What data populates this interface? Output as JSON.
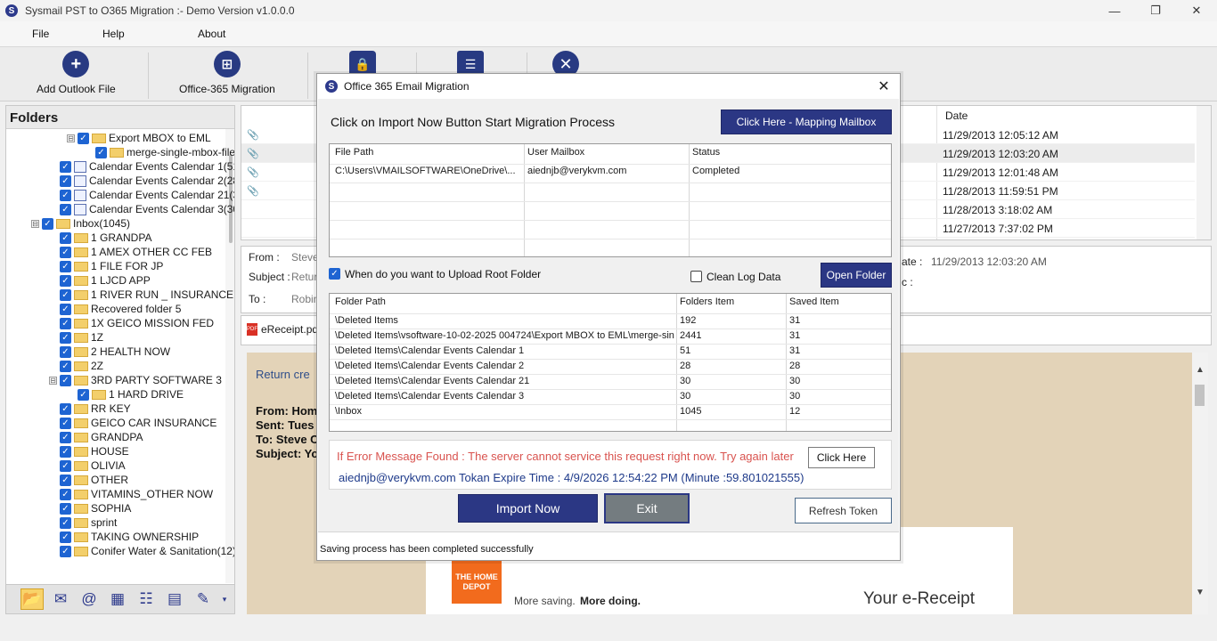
{
  "window": {
    "title": "Sysmail PST to O365 Migration :- Demo Version v1.0.0.0",
    "logo_letter": "S",
    "controls": [
      "—",
      "❐",
      "✕"
    ]
  },
  "menu": {
    "file": "File",
    "help": "Help",
    "about": "About"
  },
  "toolbar": {
    "add_outlook": "Add Outlook File",
    "office365": "Office-365 Migration"
  },
  "folders": {
    "header": "Folders",
    "items": [
      {
        "label": "Export MBOX to EML",
        "indent": 1,
        "type": "folder",
        "expander": "⊟"
      },
      {
        "label": "merge-single-mbox-file.r",
        "indent": 2,
        "type": "folder",
        "expander": ""
      },
      {
        "label": "Calendar Events Calendar 1(51",
        "indent": 0,
        "type": "cal",
        "expander": ""
      },
      {
        "label": "Calendar Events Calendar 2(28",
        "indent": 0,
        "type": "cal",
        "expander": ""
      },
      {
        "label": "Calendar Events Calendar 21(3",
        "indent": 0,
        "type": "cal",
        "expander": ""
      },
      {
        "label": "Calendar Events Calendar 3(30",
        "indent": 0,
        "type": "cal",
        "expander": ""
      },
      {
        "label": "Inbox(1045)",
        "indent": -1,
        "type": "folder",
        "expander": "⊟"
      },
      {
        "label": "1  GRANDPA",
        "indent": 0,
        "type": "folder",
        "expander": ""
      },
      {
        "label": "1 AMEX OTHER CC FEB",
        "indent": 0,
        "type": "folder",
        "expander": ""
      },
      {
        "label": "1 FILE FOR JP",
        "indent": 0,
        "type": "folder",
        "expander": ""
      },
      {
        "label": "1 LJCD APP",
        "indent": 0,
        "type": "folder",
        "expander": ""
      },
      {
        "label": "1 RIVER RUN _ INSURANCE",
        "indent": 0,
        "type": "folder",
        "expander": ""
      },
      {
        "label": "Recovered folder 5",
        "indent": 0,
        "type": "folder",
        "expander": ""
      },
      {
        "label": "1X GEICO MISSION FED",
        "indent": 0,
        "type": "folder",
        "expander": ""
      },
      {
        "label": "1Z",
        "indent": 0,
        "type": "folder",
        "expander": ""
      },
      {
        "label": "2 HEALTH NOW",
        "indent": 0,
        "type": "folder",
        "expander": ""
      },
      {
        "label": "2Z",
        "indent": 0,
        "type": "folder",
        "expander": ""
      },
      {
        "label": "3RD PARTY SOFTWARE 3",
        "indent": 0,
        "type": "folder",
        "expander": "⊟"
      },
      {
        "label": "1 HARD DRIVE",
        "indent": 1,
        "type": "folder",
        "expander": ""
      },
      {
        "label": "RR KEY",
        "indent": 0,
        "type": "folder",
        "expander": ""
      },
      {
        "label": "GEICO  CAR INSURANCE",
        "indent": 0,
        "type": "folder",
        "expander": ""
      },
      {
        "label": "GRANDPA",
        "indent": 0,
        "type": "folder",
        "expander": ""
      },
      {
        "label": "HOUSE",
        "indent": 0,
        "type": "folder",
        "expander": ""
      },
      {
        "label": "OLIVIA",
        "indent": 0,
        "type": "folder",
        "expander": ""
      },
      {
        "label": "OTHER",
        "indent": 0,
        "type": "folder",
        "expander": ""
      },
      {
        "label": "VITAMINS_OTHER NOW",
        "indent": 0,
        "type": "folder",
        "expander": ""
      },
      {
        "label": "SOPHIA",
        "indent": 0,
        "type": "folder",
        "expander": ""
      },
      {
        "label": "sprint",
        "indent": 0,
        "type": "folder",
        "expander": ""
      },
      {
        "label": "TAKING OWNERSHIP",
        "indent": 0,
        "type": "folder",
        "expander": ""
      },
      {
        "label": "Conifer Water & Sanitation(12)",
        "indent": 0,
        "type": "folder",
        "expander": ""
      }
    ]
  },
  "mail_list": {
    "date_header": "Date",
    "rows": [
      {
        "date": "11/29/2013 12:05:12 AM",
        "selected": false
      },
      {
        "date": "11/29/2013 12:03:20 AM",
        "selected": true
      },
      {
        "date": "11/29/2013 12:01:48 AM",
        "selected": false
      },
      {
        "date": "11/28/2013 11:59:51 PM",
        "selected": false
      },
      {
        "date": "11/28/2013 3:18:02 AM",
        "selected": false
      },
      {
        "date": "11/27/2013 7:37:02 PM",
        "selected": false
      }
    ]
  },
  "preview": {
    "from_label": "From :",
    "from_value": "Steve",
    "subject_label": "Subject :",
    "subject_value": "Retur",
    "to_label": "To :",
    "to_value": "Robin",
    "date_label": "ate :",
    "date_value": "11/29/2013 12:03:20 AM",
    "cc_label": "c :",
    "attachment": "eReceipt.pdf",
    "body_heading": "Return cre",
    "body_from": "From: Home",
    "body_sent": "Sent: Tues",
    "body_to": "To: Steve C",
    "body_subject": "Subject: Yo",
    "tagline_a": "More saving.",
    "tagline_b": "More doing.",
    "receipt_title": "Your e-Receipt",
    "logo_text": "THE HOME DEPOT"
  },
  "dialog": {
    "title": "Office 365 Email Migration",
    "close": "✕",
    "instruction": "Click on Import Now Button Start Migration Process",
    "mapping_button": "Click Here - Mapping Mailbox",
    "files_table": {
      "headers": [
        "File Path",
        "User Mailbox",
        "Status"
      ],
      "rows": [
        [
          "C:\\Users\\VMAILSOFTWARE\\OneDrive\\...",
          "aiednjb@verykvm.com",
          "Completed"
        ]
      ]
    },
    "upload_root_label": "When do you want to Upload Root Folder",
    "upload_root_checked": true,
    "clean_log_label": "Clean Log Data",
    "clean_log_checked": false,
    "open_folder": "Open Folder",
    "folders_table": {
      "headers": [
        "Folder Path",
        "Folders Item",
        "Saved Item"
      ],
      "rows": [
        [
          "\\Deleted Items",
          "192",
          "31"
        ],
        [
          "\\Deleted Items\\vsoftware-10-02-2025 004724\\Export MBOX to EML\\merge-sin...",
          "2441",
          "31"
        ],
        [
          "\\Deleted Items\\Calendar Events Calendar 1",
          "51",
          "31"
        ],
        [
          "\\Deleted Items\\Calendar Events Calendar 2",
          "28",
          "28"
        ],
        [
          "\\Deleted Items\\Calendar Events Calendar 21",
          "30",
          "30"
        ],
        [
          "\\Deleted Items\\Calendar Events Calendar 3",
          "30",
          "30"
        ],
        [
          "\\Inbox",
          "1045",
          "12"
        ]
      ]
    },
    "error_message": "If Error Message Found : The server cannot service this request right now. Try again later",
    "click_here": "Click Here",
    "token_text": "aiednjb@verykvm.com Tokan Expire Time : 4/9/2026 12:54:22 PM (Minute :59.801021555)",
    "import_now": "Import Now",
    "exit": "Exit",
    "refresh_token": "Refresh Token",
    "status": "Saving process has been completed successfully"
  },
  "colors": {
    "navy": "#2b3784",
    "accent_blue": "#1e64d2",
    "error_red": "#d9534f",
    "preview_bg": "#e3d3b8"
  }
}
